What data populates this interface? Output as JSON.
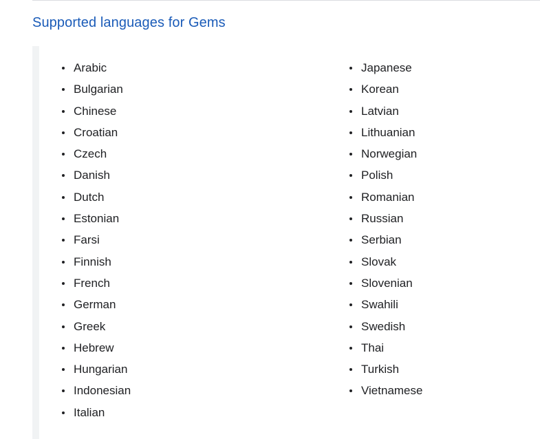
{
  "section": {
    "title": "Supported languages for Gems"
  },
  "languages": {
    "left_column": [
      "Arabic",
      "Bulgarian",
      "Chinese",
      "Croatian",
      "Czech",
      "Danish",
      "Dutch",
      "Estonian",
      "Farsi",
      "Finnish",
      "French",
      "German",
      "Greek",
      "Hebrew",
      "Hungarian",
      "Indonesian",
      "Italian"
    ],
    "right_column": [
      "Japanese",
      "Korean",
      "Latvian",
      "Lithuanian",
      "Norwegian",
      "Polish",
      "Romanian",
      "Russian",
      "Serbian",
      "Slovak",
      "Slovenian",
      "Swahili",
      "Swedish",
      "Thai",
      "Turkish",
      "Vietnamese"
    ]
  },
  "colors": {
    "title": "#1a5bb8",
    "text": "#202124",
    "callout_bar": "#f1f3f4",
    "divider": "#dadce0"
  }
}
